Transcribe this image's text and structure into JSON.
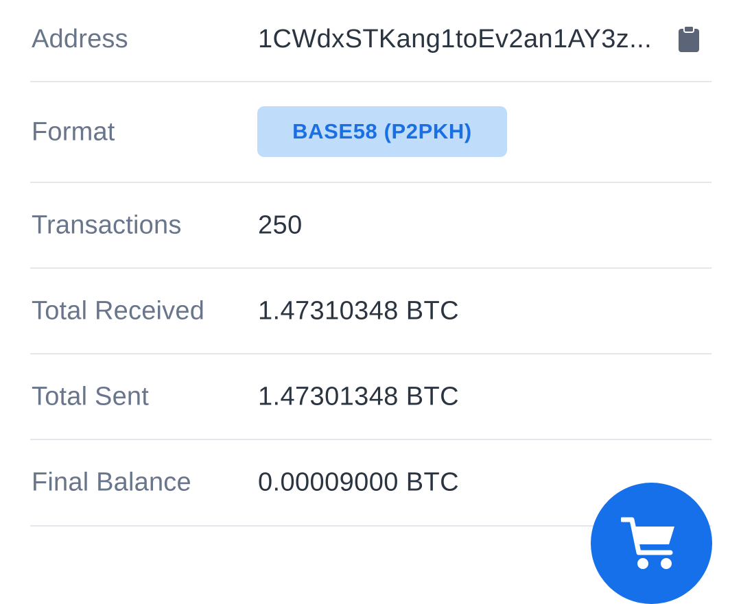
{
  "details": {
    "address": {
      "label": "Address",
      "value": "1CWdxSTKang1toEv2an1AY3z..."
    },
    "format": {
      "label": "Format",
      "badge": "BASE58 (P2PKH)"
    },
    "transactions": {
      "label": "Transactions",
      "value": "250"
    },
    "total_received": {
      "label": "Total Received",
      "value": "1.47310348 BTC"
    },
    "total_sent": {
      "label": "Total Sent",
      "value": "1.47301348 BTC"
    },
    "final_balance": {
      "label": "Final Balance",
      "value": "0.00009000 BTC"
    }
  },
  "icons": {
    "copy": "clipboard-icon",
    "fab": "shopping-cart-icon"
  },
  "colors": {
    "label": "#69758a",
    "value": "#2b3441",
    "divider": "#e3e6eb",
    "badge_bg": "#bfdcfb",
    "badge_text": "#1a6fe3",
    "fab": "#1570ea",
    "icon": "#5b6577"
  }
}
